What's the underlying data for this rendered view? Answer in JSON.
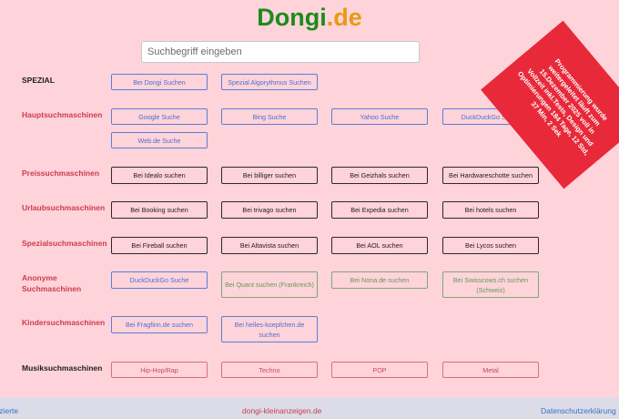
{
  "logo": {
    "part1": "Dongi",
    "part2": ".de"
  },
  "search": {
    "placeholder": "Suchbegriff eingeben"
  },
  "rows": [
    {
      "label": "SPEZIAL",
      "buttons": [
        "Bei Dongi Suchen",
        "Spezial Algorythmus Suchen"
      ]
    },
    {
      "label": "Hauptsuchmaschinen",
      "buttons": [
        "Google Suche",
        "Bing Suche",
        "Yahoo Suche",
        "DuckDuckGo Suche",
        "Web.de Suche"
      ]
    },
    {
      "label": "Preissuchmaschinen",
      "buttons": [
        "Bei Idealo suchen",
        "Bei billiger suchen",
        "Bei Geizhals suchen",
        "Bei Hardwareschotte suchen"
      ]
    },
    {
      "label": "Urlaubsuchmaschinen",
      "buttons": [
        "Bei Booking suchen",
        "Bei trivago suchen",
        "Bei Expedia suchen",
        "Bei hotels suchen"
      ]
    },
    {
      "label": "Spezialsuchmaschinen",
      "buttons": [
        "Bei Fireball suchen",
        "Bei Altavista suchen",
        "Bei AOL suchen",
        "Bei Lycos suchen"
      ]
    },
    {
      "label_line1": "Anonyme",
      "label_line2": "Suchmaschinen",
      "buttons": [
        "DuckDuckGo Suche",
        "Bei Quant suchen (Frankreich)",
        "Bei Nona.de suchen",
        "Bei Swisscows.ch suchen (Schweiz)"
      ]
    },
    {
      "label": "Kindersuchmaschinen",
      "buttons": [
        "Bei Fragfinn.de suchen",
        "Bei helles-koepfchen.de suchen"
      ]
    },
    {
      "label": "Musiksuchmaschinen",
      "buttons": [
        "Hip-Hop/Rap",
        "Techno",
        "POP",
        "Metal"
      ]
    }
  ],
  "banner": {
    "text": "Programmierung wurde weitergeleitet läuft zum 15.Dezember 2025 voll in Vollzeit inkl.Tests, Design und Optimierungen 184 Tage, 12 Std, 37 Min, 2 Sek"
  },
  "footer": {
    "left": "tzierte",
    "middle": "dongi-kleinanzeigen.de",
    "right": "Datenschutzerklärung"
  },
  "colors": {
    "background": "#ffd3da",
    "logo_green": "#1c8a1c",
    "logo_orange": "#e89a12",
    "label_red": "#cc3c4c",
    "link_blue": "#4a6fd0",
    "banner_red": "#e8293a",
    "footer_bg": "#dcdce8"
  }
}
